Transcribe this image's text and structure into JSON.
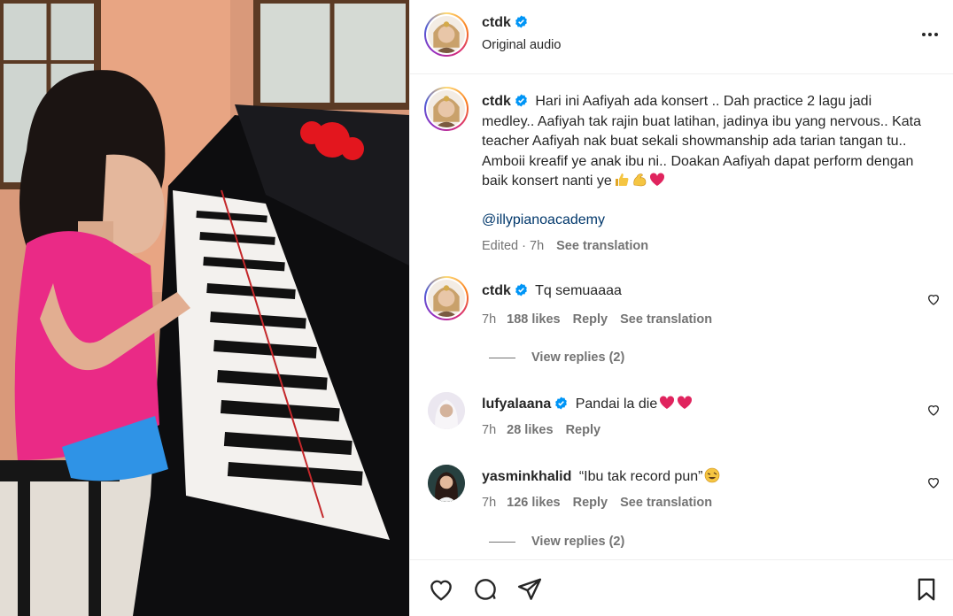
{
  "post": {
    "username": "ctdk",
    "audio": "Original audio",
    "caption": "Hari ini Aafiyah ada konsert .. Dah practice 2 lagu jadi medley.. Aafiyah tak rajin buat latihan, jadinya ibu yang nervous.. Kata teacher Aafiyah nak buat sekali showmanship ada tarian tangan tu.. Amboii kreafif ye anak ibu ni.. Doakan Aafiyah dapat perform dengan baik konsert nanti ye",
    "mention": "@illypianoacademy",
    "edited": "Edited · 7h",
    "see_translation": "See translation"
  },
  "comments": [
    {
      "username": "ctdk",
      "text": "Tq semuaaaa",
      "time": "7h",
      "likes": "188 likes",
      "reply": "Reply",
      "see_translation": "See translation",
      "view_replies": "View replies (2)"
    },
    {
      "username": "lufyalaana",
      "text": "Pandai la die",
      "time": "7h",
      "likes": "28 likes",
      "reply": "Reply"
    },
    {
      "username": "yasminkhalid",
      "text": "“Ibu tak record pun”",
      "time": "7h",
      "likes": "126 likes",
      "reply": "Reply",
      "see_translation": "See translation",
      "view_replies": "View replies (2)"
    }
  ],
  "icons": {
    "verified_color": "#0095f6",
    "heart_emoji_color": "#e0245e",
    "link_color": "#00376b",
    "muted_text_color": "#737373"
  }
}
